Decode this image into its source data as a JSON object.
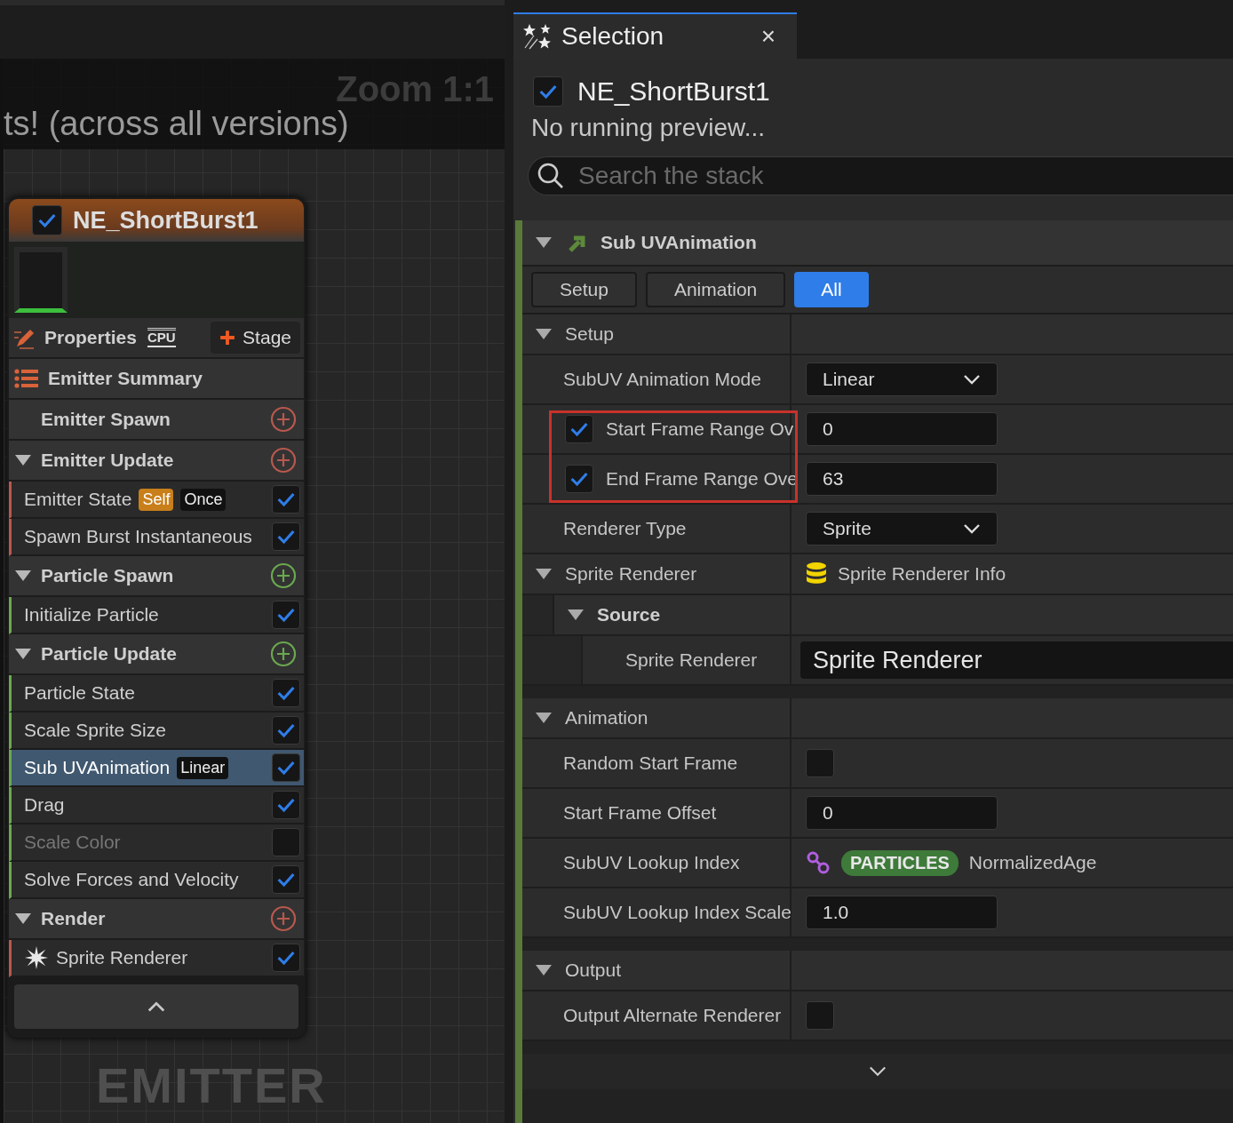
{
  "graph": {
    "zoom_label": "Zoom 1:1",
    "banner": "ts! (across all versions)",
    "watermark": "EMITTER"
  },
  "node": {
    "title": "NE_ShortBurst1",
    "enabled": true,
    "properties": "Properties",
    "sim_target": "CPU",
    "stage_button": "Stage",
    "summary": "Emitter Summary",
    "groups": [
      {
        "title": "Emitter Spawn",
        "color": "#b8584e"
      },
      {
        "title": "Emitter Update",
        "color": "#b8584e",
        "expanded": true,
        "modules": [
          {
            "kind": "module",
            "label": "Emitter State",
            "checked": true,
            "selected": false,
            "disabled": false,
            "badges": [
              {
                "text": "Self",
                "kind": "source"
              },
              {
                "text": "Once",
                "kind": "value"
              }
            ]
          },
          {
            "kind": "module",
            "label": "Spawn Burst Instantaneous",
            "checked": true,
            "selected": false,
            "disabled": false
          }
        ]
      },
      {
        "title": "Particle Spawn",
        "color": "#6aa84f",
        "expanded": true,
        "modules": [
          {
            "kind": "module",
            "label": "Initialize Particle",
            "checked": true,
            "selected": false,
            "disabled": false
          }
        ]
      },
      {
        "title": "Particle Update",
        "color": "#6aa84f",
        "expanded": true,
        "modules": [
          {
            "kind": "module",
            "label": "Particle State",
            "checked": true,
            "selected": false,
            "disabled": false
          },
          {
            "kind": "module",
            "label": "Scale Sprite Size",
            "checked": true,
            "selected": false,
            "disabled": false
          },
          {
            "kind": "module",
            "label": "Sub UVAnimation",
            "checked": true,
            "selected": true,
            "disabled": false,
            "badges": [
              {
                "text": "Linear",
                "kind": "value"
              }
            ]
          },
          {
            "kind": "module",
            "label": "Drag",
            "checked": true,
            "selected": false,
            "disabled": false
          },
          {
            "kind": "module",
            "label": "Scale Color",
            "checked": false,
            "selected": false,
            "disabled": true
          },
          {
            "kind": "module",
            "label": "Solve Forces and Velocity",
            "checked": true,
            "selected": false,
            "disabled": false
          }
        ]
      },
      {
        "title": "Render",
        "color": "#b8584e",
        "expanded": true,
        "modules": [
          {
            "kind": "renderer",
            "label": "Sprite Renderer",
            "checked": true,
            "selected": false,
            "disabled": false
          }
        ]
      }
    ]
  },
  "selection": {
    "tab_title": "Selection",
    "close": "×",
    "emitter": {
      "name": "NE_ShortBurst1",
      "enabled": true
    },
    "status": "No running preview...",
    "search": {
      "placeholder": "Search the stack"
    },
    "module": {
      "title": "Sub UVAnimation",
      "expanded": true
    },
    "filters": [
      {
        "label": "Setup",
        "selected": false
      },
      {
        "label": "Animation",
        "selected": false
      },
      {
        "label": "All",
        "selected": true
      }
    ],
    "sections": [
      {
        "title": "Setup",
        "expanded": true,
        "rows": [
          {
            "kind": "dropdown",
            "label": "SubUV Animation Mode",
            "value": "Linear"
          },
          {
            "kind": "group",
            "highlighted": true,
            "rows": [
              {
                "kind": "override",
                "label": "Start Frame Range Ov",
                "checked": true,
                "value": "0"
              },
              {
                "kind": "override",
                "label": "End Frame Range Ove",
                "checked": true,
                "value": "63"
              }
            ]
          },
          {
            "kind": "dropdown",
            "label": "Renderer Type",
            "value": "Sprite"
          }
        ]
      },
      {
        "title": "Sprite Renderer",
        "expanded": true,
        "info": "Sprite Renderer Info",
        "children": [
          {
            "title": "Source",
            "expanded": true,
            "rows": [
              {
                "kind": "asset",
                "label": "Sprite Renderer",
                "value": "Sprite Renderer"
              }
            ]
          }
        ]
      },
      {
        "title": "Animation",
        "expanded": true,
        "rows": [
          {
            "kind": "checkbox",
            "label": "Random Start Frame",
            "checked": false
          },
          {
            "kind": "number",
            "label": "Start Frame Offset",
            "value": "0"
          },
          {
            "kind": "binding",
            "label": "SubUV Lookup Index",
            "namespace": "PARTICLES",
            "value": "NormalizedAge"
          },
          {
            "kind": "number",
            "label": "SubUV Lookup Index Scale",
            "value": "1.0"
          }
        ]
      },
      {
        "title": "Output",
        "expanded": true,
        "rows": [
          {
            "kind": "checkbox",
            "label": "Output Alternate Renderer",
            "checked": false
          }
        ]
      }
    ]
  }
}
